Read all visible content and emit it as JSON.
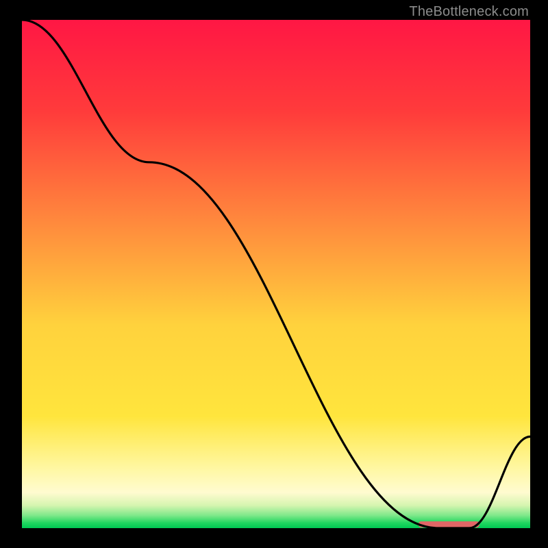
{
  "attribution": "TheBottleneck.com",
  "chart_data": {
    "type": "line",
    "title": "",
    "xlabel": "",
    "ylabel": "",
    "xlim": [
      0,
      100
    ],
    "ylim": [
      0,
      100
    ],
    "series": [
      {
        "name": "curve",
        "x": [
          0,
          25,
          82,
          88,
          100
        ],
        "y": [
          100,
          72,
          0,
          0,
          18
        ]
      }
    ],
    "marker": {
      "x_start": 78,
      "x_end": 90,
      "y": 0.8,
      "color": "#e06666"
    },
    "gradient_stops": [
      {
        "pos": 0.0,
        "color": "#ff1744"
      },
      {
        "pos": 0.18,
        "color": "#ff3b3b"
      },
      {
        "pos": 0.4,
        "color": "#ff8a3d"
      },
      {
        "pos": 0.6,
        "color": "#ffd23d"
      },
      {
        "pos": 0.78,
        "color": "#ffe53d"
      },
      {
        "pos": 0.88,
        "color": "#fff7a0"
      },
      {
        "pos": 0.93,
        "color": "#fffbd0"
      },
      {
        "pos": 0.955,
        "color": "#d6f5b0"
      },
      {
        "pos": 0.975,
        "color": "#7fe88a"
      },
      {
        "pos": 0.99,
        "color": "#1fd65f"
      },
      {
        "pos": 1.0,
        "color": "#00c853"
      }
    ]
  }
}
